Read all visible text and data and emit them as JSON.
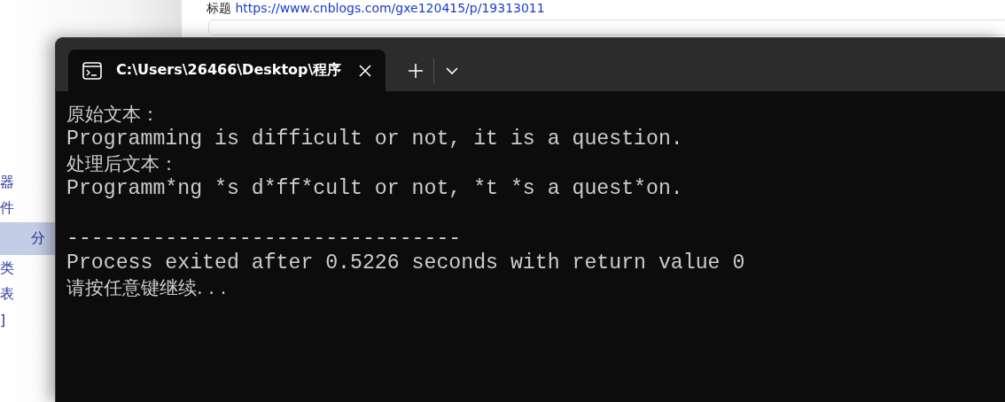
{
  "background_page": {
    "title_label": "标题",
    "url": "https://www.cnblogs.com/gxe120415/p/19313011",
    "sidebar_items": [
      {
        "label": "器",
        "selected": false
      },
      {
        "label": "件",
        "selected": false
      },
      {
        "label": "分",
        "selected": true
      },
      {
        "label": "类",
        "selected": false
      },
      {
        "label": "表",
        "selected": false
      },
      {
        "label": "]",
        "selected": false
      }
    ]
  },
  "terminal": {
    "tabs": [
      {
        "title": "C:\\Users\\26466\\Desktop\\程序",
        "selected": true
      }
    ],
    "output_lines": [
      {
        "kind": "text",
        "text": "原始文本："
      },
      {
        "kind": "text",
        "text": "Programming is difficult or not, it is a question."
      },
      {
        "kind": "text",
        "text": "处理后文本："
      },
      {
        "kind": "text",
        "text": "Programm*ng *s d*ff*cult or not, *t *s a quest*on."
      },
      {
        "kind": "blank"
      },
      {
        "kind": "text",
        "text": "--------------------------------"
      },
      {
        "kind": "text",
        "text": "Process exited after 0.5226 seconds with return value 0"
      },
      {
        "kind": "text",
        "text": "请按任意键继续. . ."
      }
    ]
  }
}
